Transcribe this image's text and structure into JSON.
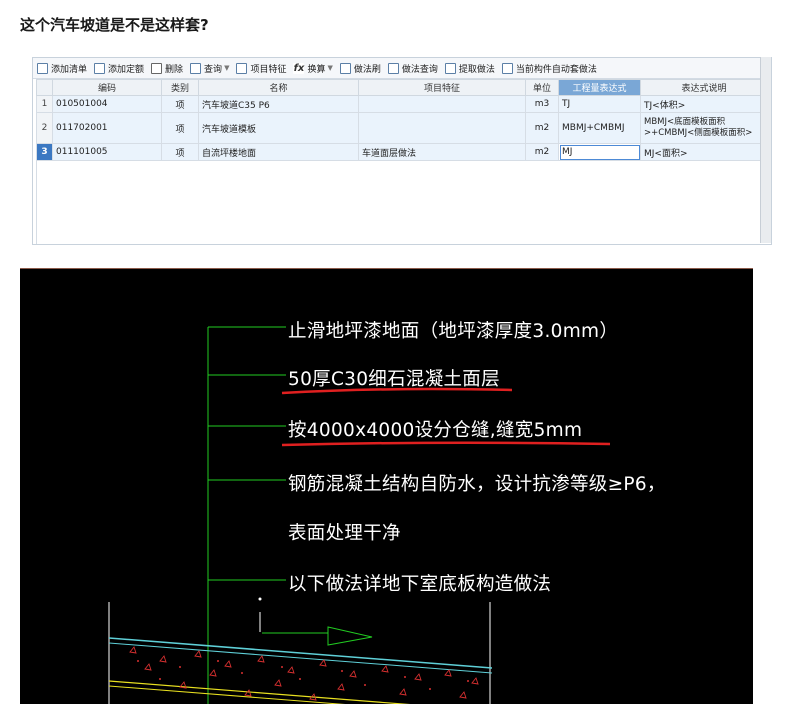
{
  "question": "这个汽车坡道是不是这样套?",
  "toolbar": {
    "buttons": [
      {
        "label": "添加清单",
        "icon": "add-list-icon"
      },
      {
        "label": "添加定额",
        "icon": "add-quota-icon"
      },
      {
        "label": "删除",
        "icon": "trash-icon"
      },
      {
        "label": "查询",
        "icon": "search-icon",
        "dropdown": true
      },
      {
        "label": "项目特征",
        "icon": "feature-icon"
      },
      {
        "label": "换算",
        "icon": "fx-icon",
        "dropdown": true
      },
      {
        "label": "做法刷",
        "icon": "brush-icon"
      },
      {
        "label": "做法查询",
        "icon": "method-search-icon"
      },
      {
        "label": "提取做法",
        "icon": "extract-icon"
      },
      {
        "label": "当前构件自动套做法",
        "icon": "auto-apply-icon"
      }
    ],
    "more": "»"
  },
  "grid": {
    "columns": [
      "编码",
      "类别",
      "名称",
      "项目特征",
      "单位",
      "工程量表达式",
      "表达式说明"
    ],
    "active_column": "工程量表达式",
    "rows": [
      {
        "no": "1",
        "code": "010501004",
        "type": "项",
        "name": "汽车坡道C35 P6",
        "feature": "",
        "unit": "m3",
        "expr": "TJ",
        "desc": "TJ<体积>"
      },
      {
        "no": "2",
        "code": "011702001",
        "type": "项",
        "name": "汽车坡道模板",
        "feature": "",
        "unit": "m2",
        "expr": "MBMJ+CMBMJ",
        "desc": "MBMJ<底面模板面积>+CMBMJ<侧面模板面积>"
      },
      {
        "no": "3",
        "code": "011101005",
        "type": "项",
        "name": "自流坪楼地面",
        "feature": "车道面层做法",
        "unit": "m2",
        "expr": "MJ",
        "desc": "MJ<面积>"
      }
    ],
    "selected_row": 3
  },
  "cad": {
    "lines": [
      "止滑地坪漆地面（地坪漆厚度3.0mm）",
      "50厚C30细石混凝土面层",
      "按4000x4000设分仓缝,缝宽5mm",
      "钢筋混凝土结构自防水，设计抗渗等级≥P6，",
      "表面处理干净",
      "以下做法详地下室底板构造做法"
    ],
    "colors": {
      "background": "#000000",
      "text": "#ffffff",
      "leader": "#22cc22",
      "underline": "#e02020",
      "surface": "#5fd0d8",
      "rebar": "#e8e020",
      "hatch": "#d83030"
    }
  }
}
